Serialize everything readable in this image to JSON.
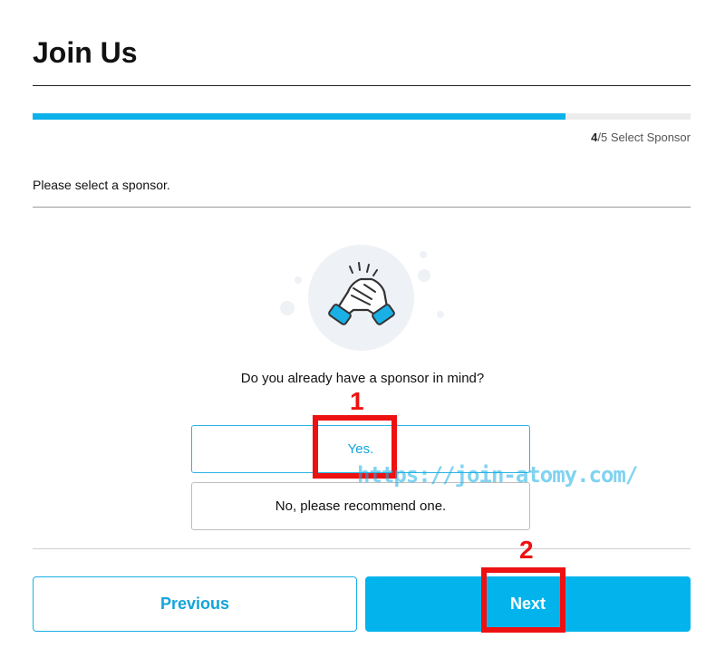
{
  "header": {
    "title": "Join Us"
  },
  "progress": {
    "fraction": 0.81,
    "current_step": "4",
    "step_suffix": "/5 Select Sponsor"
  },
  "prompt": "Please select a sponsor.",
  "illustration": {
    "icon": "handshake-icon"
  },
  "question": "Do you already have a sponsor in mind?",
  "options": {
    "yes": "Yes.",
    "no": "No, please recommend one."
  },
  "nav": {
    "previous": "Previous",
    "next": "Next"
  },
  "annotations": {
    "marker_1": "1",
    "marker_2": "2"
  },
  "watermark": "https://join-atomy.com/",
  "colors": {
    "accent": "#03b4ec",
    "highlight": "#ee1111"
  }
}
